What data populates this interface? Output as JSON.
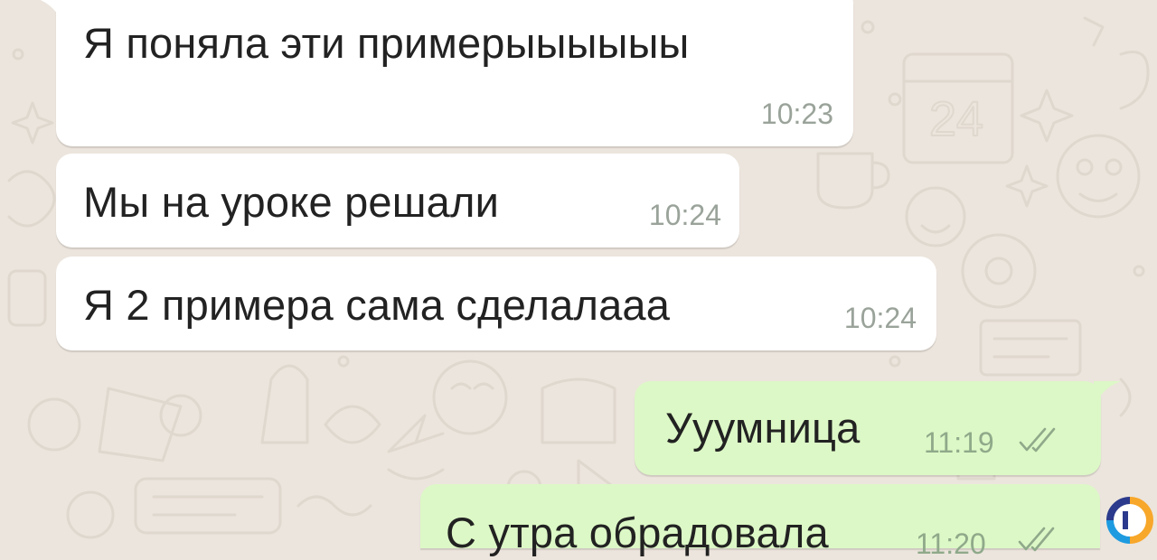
{
  "chat": {
    "messages": [
      {
        "direction": "incoming",
        "text": "Я поняла эти примерыыыыыы",
        "time": "10:23"
      },
      {
        "direction": "incoming",
        "text": "Мы на уроке решали",
        "time": "10:24"
      },
      {
        "direction": "incoming",
        "text": "Я 2 примера сама сделалааа",
        "time": "10:24"
      },
      {
        "direction": "outgoing",
        "text": "Ууумница",
        "time": "11:19",
        "status": "read"
      },
      {
        "direction": "outgoing",
        "text": "С утра обрадовала",
        "time": "11:20",
        "status": "read"
      }
    ]
  },
  "colors": {
    "background": "#ece5dd",
    "incoming_bubble": "#ffffff",
    "outgoing_bubble": "#dcf8c6",
    "read_ticks": "#8fa98a"
  },
  "icons": {
    "read_status": "double-check-icon",
    "watermark": "brand-logo-icon"
  }
}
